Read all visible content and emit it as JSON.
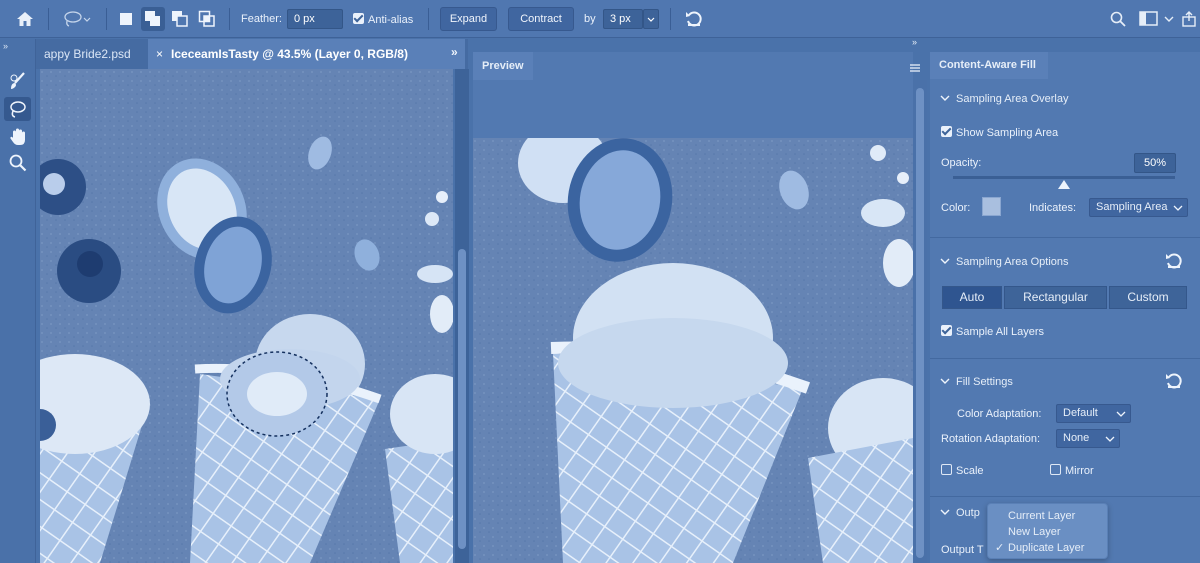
{
  "options_bar": {
    "feather_label": "Feather:",
    "feather_value": "0 px",
    "antialias_label": "Anti-alias",
    "expand_label": "Expand",
    "contract_label": "Contract",
    "by_label": "by",
    "by_value": "3 px"
  },
  "tabs": [
    {
      "label": "appy Bride2.psd"
    },
    {
      "close": "×",
      "label": "IceceamIsTasty @ 43.5% (Layer 0, RGB/8)"
    }
  ],
  "preview_tab": {
    "label": "Preview"
  },
  "panel": {
    "title": "Content-Aware Fill",
    "sampling_overlay": {
      "title": "Sampling Area Overlay",
      "show_label": "Show Sampling Area",
      "opacity_label": "Opacity:",
      "opacity_value": "50%",
      "opacity_level": 0.5,
      "color_label": "Color:",
      "indicates_label": "Indicates:",
      "indicates_value": "Sampling Area"
    },
    "sampling_options": {
      "title": "Sampling Area Options",
      "modes": [
        "Auto",
        "Rectangular",
        "Custom"
      ],
      "selected_mode": "Auto",
      "sample_all_label": "Sample All Layers"
    },
    "fill_settings": {
      "title": "Fill Settings",
      "color_adaptation_label": "Color Adaptation:",
      "color_adaptation_value": "Default",
      "rotation_adaptation_label": "Rotation Adaptation:",
      "rotation_adaptation_value": "None",
      "scale_label": "Scale",
      "mirror_label": "Mirror"
    },
    "output": {
      "title": "Outp",
      "output_to_label": "Output T"
    },
    "output_menu": {
      "options": [
        "Current Layer",
        "New Layer",
        "Duplicate Layer"
      ],
      "selected": "Duplicate Layer",
      "check": "✓"
    }
  },
  "colors": {
    "ui_base": "#4a72aa",
    "panel": "#5279b1",
    "canvas_bg": "#5f7fb0"
  }
}
